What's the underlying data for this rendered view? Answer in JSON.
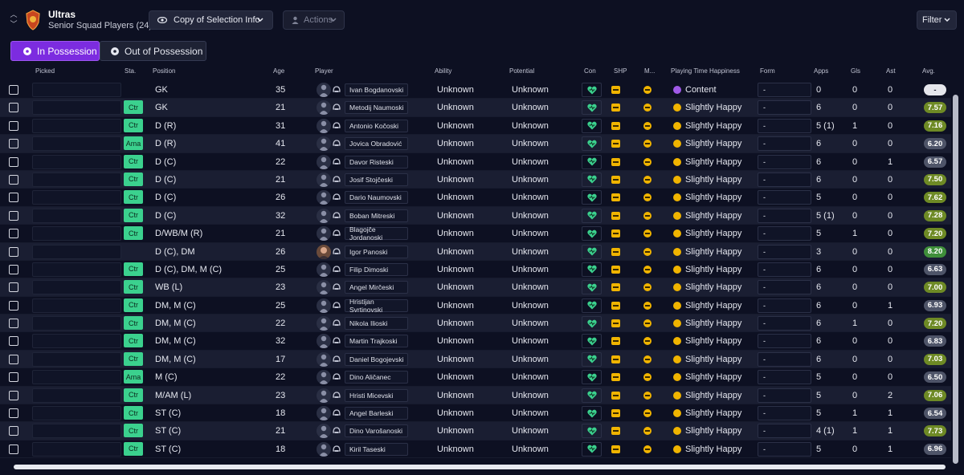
{
  "header": {
    "club_name": "Ultras",
    "subtitle": "Senior Squad Players (24)",
    "view_button": "Copy of Selection Info",
    "actions_button": "Actions",
    "filter_button": "Filter"
  },
  "tabs": {
    "in_possession": "In Possession",
    "out_of_possession": "Out of Possession"
  },
  "columns": {
    "picked": "Picked",
    "sta": "Sta.",
    "position": "Position",
    "age": "Age",
    "player": "Player",
    "ability": "Ability",
    "potential": "Potential",
    "con": "Con",
    "shp": "SHP",
    "m": "M...",
    "pth": "Playing Time Happiness",
    "form": "Form",
    "apps": "Apps",
    "gls": "Gls",
    "ast": "Ast",
    "avg": "Avg."
  },
  "colors": {
    "accent": "#7c2ce0",
    "status_green": "#3bd18e",
    "avg_low": "#5b6178",
    "avg_mid": "#6b7a2a",
    "avg_high": "#3d8a3a"
  },
  "rows": [
    {
      "sta": "",
      "pos": "GK",
      "age": "35",
      "name": "Ivan Bogdanovski",
      "ability": "Unknown",
      "potential": "Unknown",
      "pth": "Content",
      "form": "-",
      "apps": "0",
      "gls": "0",
      "ast": "0",
      "avg": "-",
      "avg_color": "#e5e6ec",
      "has_photo": false
    },
    {
      "sta": "Ctr",
      "pos": "GK",
      "age": "21",
      "name": "Metodij Naumoski",
      "ability": "Unknown",
      "potential": "Unknown",
      "pth": "Slightly Happy",
      "form": "-",
      "apps": "6",
      "gls": "0",
      "ast": "0",
      "avg": "7.57",
      "avg_color": "#6e8a25",
      "has_photo": false
    },
    {
      "sta": "Ctr",
      "pos": "D (R)",
      "age": "31",
      "name": "Antonio Kočoski",
      "ability": "Unknown",
      "potential": "Unknown",
      "pth": "Slightly Happy",
      "form": "-",
      "apps": "5 (1)",
      "gls": "1",
      "ast": "0",
      "avg": "7.16",
      "avg_color": "#6e8a25",
      "has_photo": false
    },
    {
      "sta": "Ama",
      "pos": "D (R)",
      "age": "41",
      "name": "Jovica Obradović",
      "ability": "Unknown",
      "potential": "Unknown",
      "pth": "Slightly Happy",
      "form": "-",
      "apps": "6",
      "gls": "0",
      "ast": "0",
      "avg": "6.20",
      "avg_color": "#4e5468",
      "has_photo": false
    },
    {
      "sta": "Ctr",
      "pos": "D (C)",
      "age": "22",
      "name": "Davor Risteski",
      "ability": "Unknown",
      "potential": "Unknown",
      "pth": "Slightly Happy",
      "form": "-",
      "apps": "6",
      "gls": "0",
      "ast": "1",
      "avg": "6.57",
      "avg_color": "#4e5468",
      "has_photo": false
    },
    {
      "sta": "Ctr",
      "pos": "D (C)",
      "age": "21",
      "name": "Josif Stojčeski",
      "ability": "Unknown",
      "potential": "Unknown",
      "pth": "Slightly Happy",
      "form": "-",
      "apps": "6",
      "gls": "0",
      "ast": "0",
      "avg": "7.50",
      "avg_color": "#6e8a25",
      "has_photo": false
    },
    {
      "sta": "Ctr",
      "pos": "D (C)",
      "age": "26",
      "name": "Dario Naumovski",
      "ability": "Unknown",
      "potential": "Unknown",
      "pth": "Slightly Happy",
      "form": "-",
      "apps": "5",
      "gls": "0",
      "ast": "0",
      "avg": "7.62",
      "avg_color": "#6e8a25",
      "has_photo": false
    },
    {
      "sta": "Ctr",
      "pos": "D (C)",
      "age": "32",
      "name": "Boban Mitreski",
      "ability": "Unknown",
      "potential": "Unknown",
      "pth": "Slightly Happy",
      "form": "-",
      "apps": "5 (1)",
      "gls": "0",
      "ast": "0",
      "avg": "7.28",
      "avg_color": "#6e8a25",
      "has_photo": false
    },
    {
      "sta": "Ctr",
      "pos": "D/WB/M (R)",
      "age": "21",
      "name": "Blagojče Jordanoski",
      "ability": "Unknown",
      "potential": "Unknown",
      "pth": "Slightly Happy",
      "form": "-",
      "apps": "5",
      "gls": "1",
      "ast": "0",
      "avg": "7.20",
      "avg_color": "#6e8a25",
      "has_photo": false
    },
    {
      "sta": "",
      "pos": "D (C), DM",
      "age": "26",
      "name": "Igor Panoski",
      "ability": "Unknown",
      "potential": "Unknown",
      "pth": "Slightly Happy",
      "form": "-",
      "apps": "3",
      "gls": "0",
      "ast": "0",
      "avg": "8.20",
      "avg_color": "#3f8f3a",
      "has_photo": true
    },
    {
      "sta": "Ctr",
      "pos": "D (C), DM, M (C)",
      "age": "25",
      "name": "Filip Dimoski",
      "ability": "Unknown",
      "potential": "Unknown",
      "pth": "Slightly Happy",
      "form": "-",
      "apps": "6",
      "gls": "0",
      "ast": "0",
      "avg": "6.63",
      "avg_color": "#4e5468",
      "has_photo": false
    },
    {
      "sta": "Ctr",
      "pos": "WB (L)",
      "age": "23",
      "name": "Angel Mirčeski",
      "ability": "Unknown",
      "potential": "Unknown",
      "pth": "Slightly Happy",
      "form": "-",
      "apps": "6",
      "gls": "0",
      "ast": "0",
      "avg": "7.00",
      "avg_color": "#6e8a25",
      "has_photo": false
    },
    {
      "sta": "Ctr",
      "pos": "DM, M (C)",
      "age": "25",
      "name": "Hristijan Svrtinovski",
      "ability": "Unknown",
      "potential": "Unknown",
      "pth": "Slightly Happy",
      "form": "-",
      "apps": "6",
      "gls": "0",
      "ast": "1",
      "avg": "6.93",
      "avg_color": "#4e5468",
      "has_photo": false
    },
    {
      "sta": "Ctr",
      "pos": "DM, M (C)",
      "age": "22",
      "name": "Nikola Ilioski",
      "ability": "Unknown",
      "potential": "Unknown",
      "pth": "Slightly Happy",
      "form": "-",
      "apps": "6",
      "gls": "1",
      "ast": "0",
      "avg": "7.20",
      "avg_color": "#6e8a25",
      "has_photo": false
    },
    {
      "sta": "Ctr",
      "pos": "DM, M (C)",
      "age": "32",
      "name": "Martin Trajkoski",
      "ability": "Unknown",
      "potential": "Unknown",
      "pth": "Slightly Happy",
      "form": "-",
      "apps": "6",
      "gls": "0",
      "ast": "0",
      "avg": "6.83",
      "avg_color": "#4e5468",
      "has_photo": false
    },
    {
      "sta": "Ctr",
      "pos": "DM, M (C)",
      "age": "17",
      "name": "Daniel Bogojevski",
      "ability": "Unknown",
      "potential": "Unknown",
      "pth": "Slightly Happy",
      "form": "-",
      "apps": "6",
      "gls": "0",
      "ast": "0",
      "avg": "7.03",
      "avg_color": "#6e8a25",
      "has_photo": false
    },
    {
      "sta": "Ama",
      "pos": "M (C)",
      "age": "22",
      "name": "Dino Aličanec",
      "ability": "Unknown",
      "potential": "Unknown",
      "pth": "Slightly Happy",
      "form": "-",
      "apps": "5",
      "gls": "0",
      "ast": "0",
      "avg": "6.50",
      "avg_color": "#4e5468",
      "has_photo": false
    },
    {
      "sta": "Ctr",
      "pos": "M/AM (L)",
      "age": "23",
      "name": "Hristi Micevski",
      "ability": "Unknown",
      "potential": "Unknown",
      "pth": "Slightly Happy",
      "form": "-",
      "apps": "5",
      "gls": "0",
      "ast": "2",
      "avg": "7.06",
      "avg_color": "#6e8a25",
      "has_photo": false
    },
    {
      "sta": "Ctr",
      "pos": "ST (C)",
      "age": "18",
      "name": "Angel Barleski",
      "ability": "Unknown",
      "potential": "Unknown",
      "pth": "Slightly Happy",
      "form": "-",
      "apps": "5",
      "gls": "1",
      "ast": "1",
      "avg": "6.54",
      "avg_color": "#4e5468",
      "has_photo": false
    },
    {
      "sta": "Ctr",
      "pos": "ST (C)",
      "age": "21",
      "name": "Dino Varošanoski",
      "ability": "Unknown",
      "potential": "Unknown",
      "pth": "Slightly Happy",
      "form": "-",
      "apps": "4 (1)",
      "gls": "1",
      "ast": "1",
      "avg": "7.73",
      "avg_color": "#6e8a25",
      "has_photo": false
    },
    {
      "sta": "Ctr",
      "pos": "ST (C)",
      "age": "18",
      "name": "Kiril Taseski",
      "ability": "Unknown",
      "potential": "Unknown",
      "pth": "Slightly Happy",
      "form": "-",
      "apps": "5",
      "gls": "0",
      "ast": "1",
      "avg": "6.96",
      "avg_color": "#4e5468",
      "has_photo": false
    }
  ]
}
